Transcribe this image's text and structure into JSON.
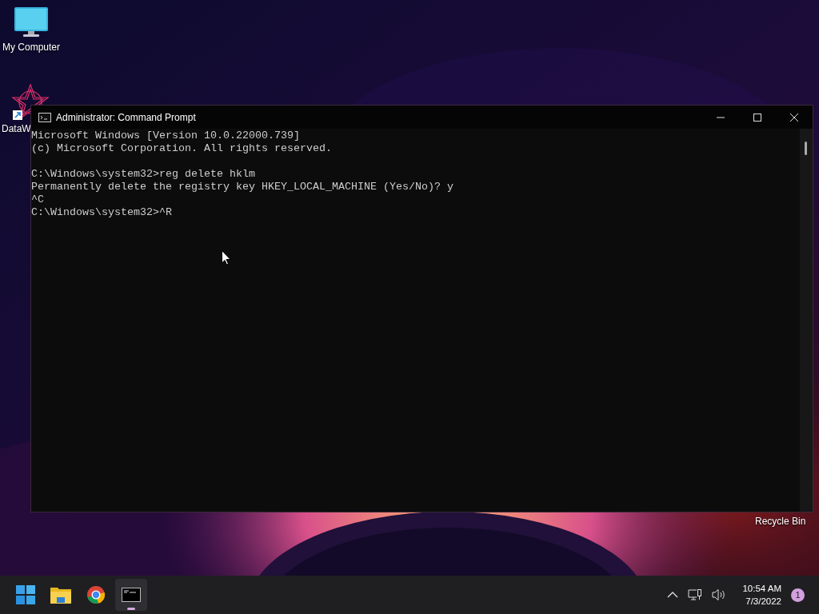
{
  "desktop": {
    "icons": [
      {
        "label": "My Computer",
        "kind": "computer"
      },
      {
        "label": "DataW",
        "kind": "shortcut"
      },
      {
        "label": "Recycle Bin",
        "kind": "label-only"
      }
    ]
  },
  "window": {
    "title": "Administrator: Command Prompt",
    "console": [
      [
        "Microsoft Windows [Version 10.0.22000.739]",
        "(c) Microsoft Corporation. All rights reserved."
      ],
      [
        "C:\\Windows\\system32>reg delete hklm",
        "Permanently delete the registry key HKEY_LOCAL_MACHINE (Yes/No)? y",
        "^C",
        "C:\\Windows\\system32>^R"
      ]
    ]
  },
  "taskbar": {
    "apps": [
      {
        "kind": "start",
        "selected": false
      },
      {
        "kind": "explorer",
        "selected": false
      },
      {
        "kind": "browser",
        "selected": false
      },
      {
        "kind": "terminal",
        "selected": true
      }
    ],
    "clock": {
      "time": "10:54 AM",
      "date": "7/3/2022"
    },
    "notifications": "1"
  }
}
